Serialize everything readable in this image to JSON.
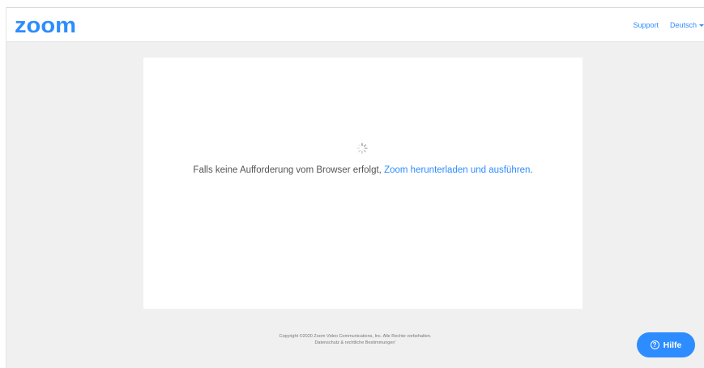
{
  "header": {
    "logo_text": "zoom",
    "support_label": "Support",
    "language_label": "Deutsch"
  },
  "main": {
    "message_prefix": "Falls keine Aufforderung vom Browser erfolgt, ",
    "download_link_label": "Zoom herunterladen und ausführen",
    "message_suffix": "."
  },
  "footer": {
    "copyright": "Copyright ©2020 Zoom Video Communications, Inc. Alle Rechte vorbehalten.",
    "legal_link": "Datenschutz & rechtliche Bestimmungen'"
  },
  "help_button": {
    "icon_glyph": "?",
    "label": "Hilfe"
  },
  "colors": {
    "brand_blue": "#2d8cff",
    "page_background": "#f0f0f0",
    "body_text": "#555555"
  },
  "icons": [
    "zoom-logo",
    "chevron-down-icon",
    "loading-spinner-icon",
    "help-icon"
  ]
}
